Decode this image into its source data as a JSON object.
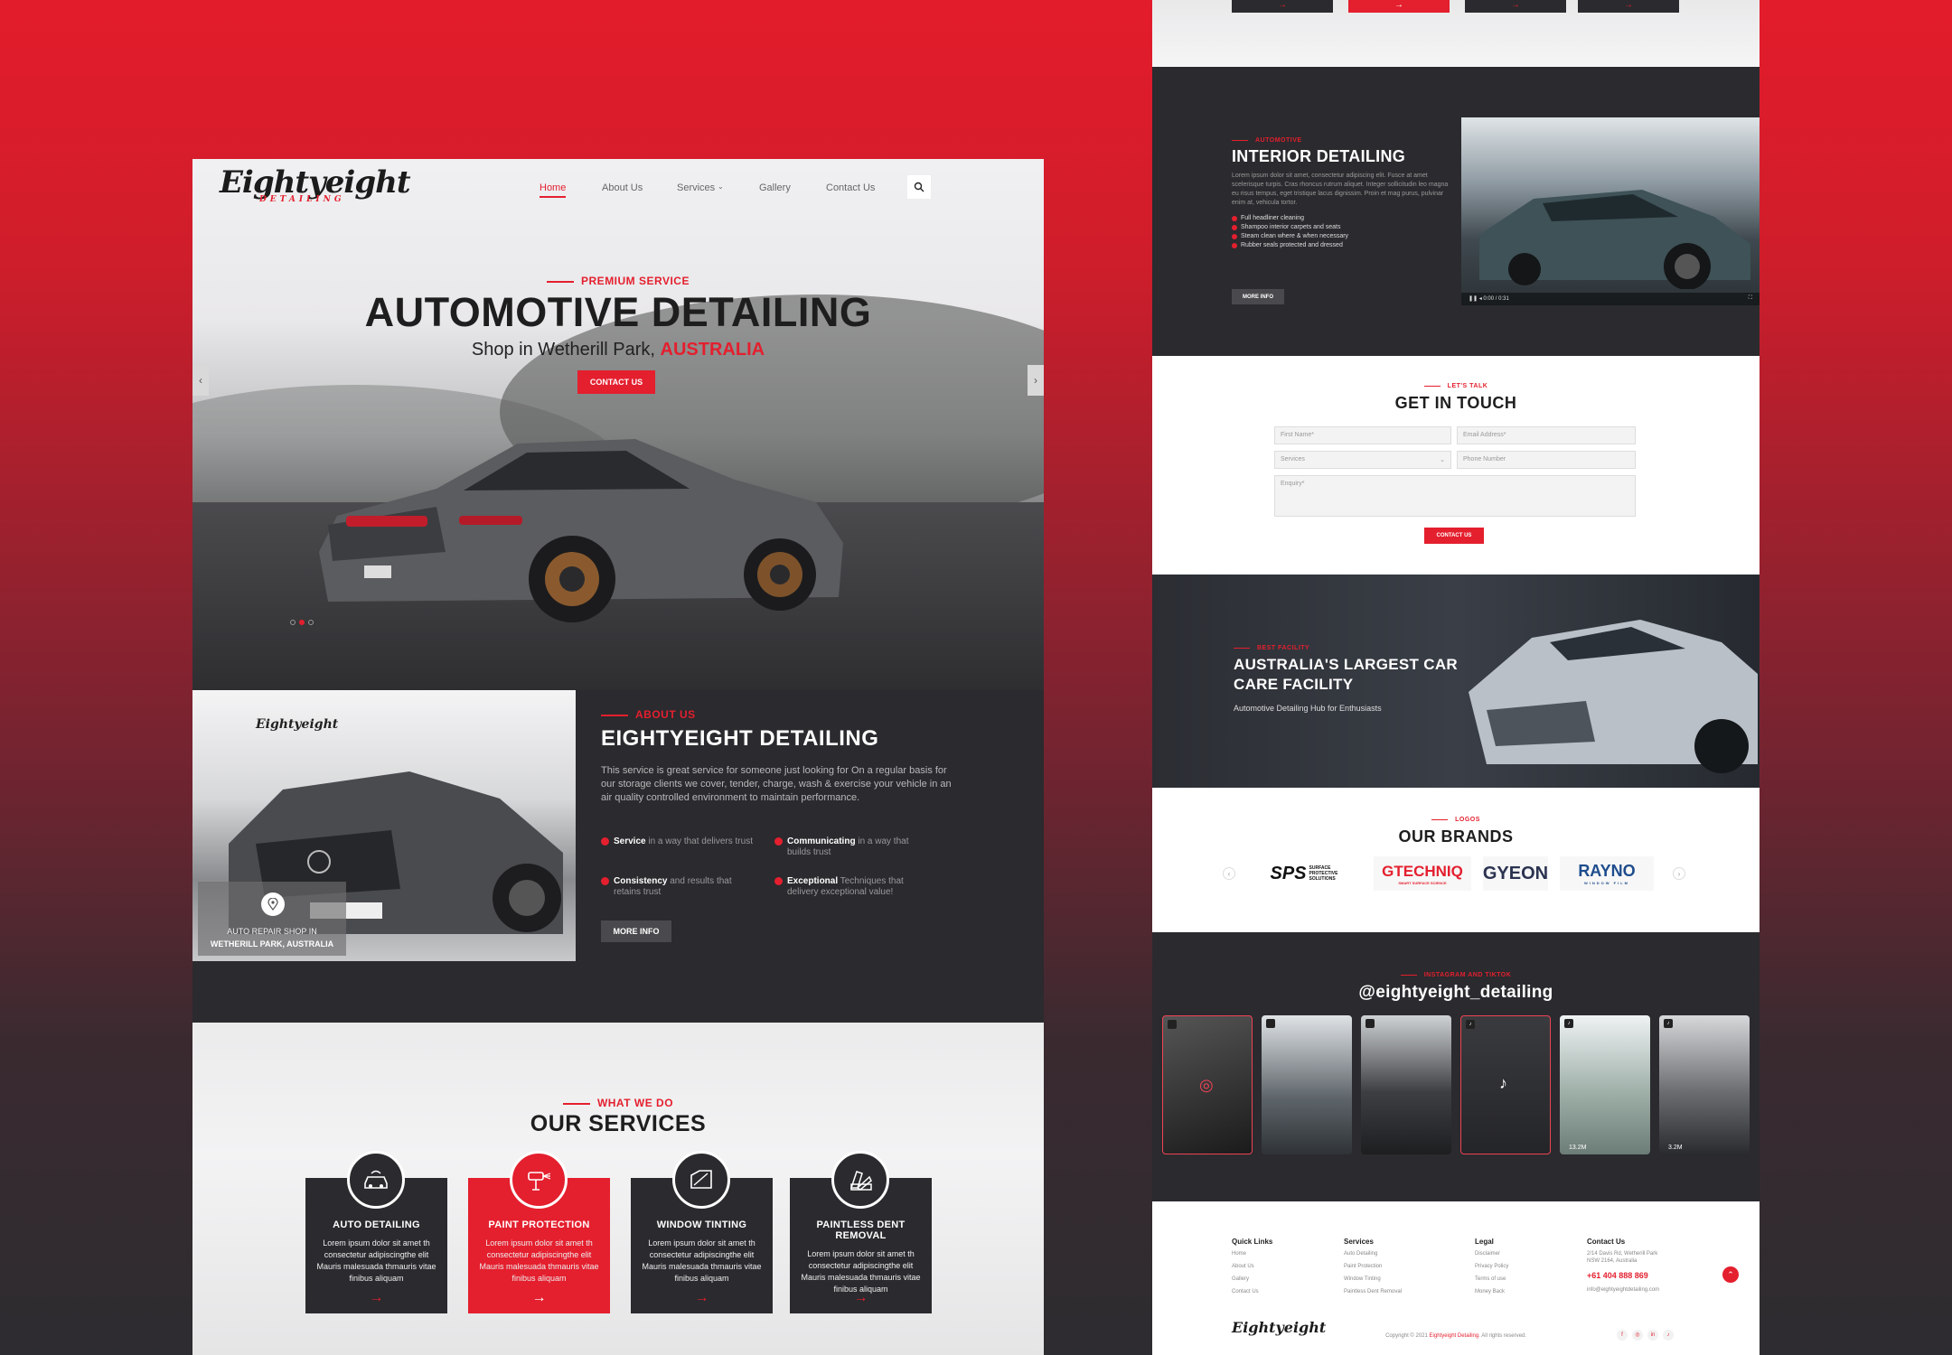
{
  "colors": {
    "accent": "#e41f2e",
    "dark": "#2b2a2e",
    "background": "#e31c2b"
  },
  "left": {
    "logo": {
      "name": "Eightyeight",
      "sub": "DETAILING"
    },
    "nav": [
      "Home",
      "About Us",
      "Services",
      "Gallery",
      "Contact Us"
    ],
    "hero": {
      "kicker": "PREMIUM SERVICE",
      "title": "AUTOMOTIVE DETAILING",
      "subtitle": "Shop in Wetherill Park,",
      "subtitle_highlight": "AUSTRALIA",
      "button": "CONTACT US",
      "active_slide": 2,
      "slide_count": 3
    },
    "about": {
      "kicker": "ABOUT US",
      "title": "EIGHTYEIGHT DETAILING",
      "text": "This service is great service for someone just looking for On a regular basis for our storage clients we cover, tender, charge, wash & exercise your vehicle in an air quality controlled environment to maintain performance.",
      "badge_line1": "AUTO REPAIR SHOP IN",
      "badge_line2": "WETHERILL PARK,  AUSTRALIA",
      "features": [
        {
          "bold": "Service",
          "rest": " in a way that delivers trust"
        },
        {
          "bold": "Communicating",
          "rest": " in a way that builds trust"
        },
        {
          "bold": "Consistency",
          "rest": " and results that retains trust"
        },
        {
          "bold": "Exceptional",
          "rest": " Techniques that delivery exceptional value!"
        }
      ],
      "button": "MORE INFO"
    },
    "services": {
      "kicker": "WHAT WE DO",
      "title": "OUR SERVICES",
      "cards": [
        {
          "title": "AUTO DETAILING",
          "text": "Lorem ipsum dolor sit amet th consectetur adipiscingthe elit Mauris malesuada thmauris vitae finibus aliquam",
          "icon": "car-wash-icon"
        },
        {
          "title": "PAINT PROTECTION",
          "text": "Lorem ipsum dolor sit amet th consectetur adipiscingthe elit Mauris malesuada thmauris vitae finibus aliquam",
          "icon": "spray-gun-icon"
        },
        {
          "title": "WINDOW TINTING",
          "text": "Lorem ipsum dolor sit amet th consectetur adipiscingthe elit Mauris malesuada thmauris vitae finibus aliquam",
          "icon": "window-tint-icon"
        },
        {
          "title": "PAINTLESS DENT REMOVAL",
          "text": "Lorem ipsum dolor sit amet th consectetur adipiscingthe elit Mauris malesuada thmauris vitae finibus aliquam",
          "icon": "swatch-icon"
        }
      ]
    }
  },
  "right": {
    "interior": {
      "kicker": "AUTOMOTIVE",
      "title": "INTERIOR DETAILING",
      "text": "Lorem ipsum dolor sit amet, consectetur adipiscing elit. Fusce at amet scelerisque turpis. Cras rhoncus rutrum aliquet. Integer sollicitudin leo magna eu risus tempus, eget tristique lacus dignissim. Proin et mag purus, pulvinar enim at, vehicula tortor.",
      "bullets": [
        "Full headliner cleaning",
        "Shampoo interior carpets and seats",
        "Steam clean where & when necessary",
        "Rubber seals protected and dressed"
      ],
      "button": "MORE INFO",
      "video_time": "0:00 / 0:31"
    },
    "contact": {
      "kicker": "LET'S TALK",
      "title": "GET IN TOUCH",
      "fields": {
        "first_name": "First Name*",
        "email": "Email Address*",
        "services": "Services",
        "phone": "Phone Number",
        "enquiry": "Enquiry*"
      },
      "button": "CONTACT US"
    },
    "facility": {
      "kicker": "BEST FACILITY",
      "title": "AUSTRALIA'S LARGEST CAR CARE FACILITY",
      "subtitle": "Automotive Detailing Hub for Enthusiasts"
    },
    "brands": {
      "kicker": "LOGOS",
      "title": "OUR BRANDS",
      "items": [
        "SPS",
        "GTECHNIQ",
        "GYEON",
        "RAYNO"
      ],
      "sps_sub": "SURFACE PROTECTIVE SOLUTIONS",
      "gtech_sub": "SMART SURFACE SCIENCE",
      "rayno_sub": "WINDOW FILM"
    },
    "instagram": {
      "kicker": "INSTAGRAM AND TIKTOK",
      "handle": "@eightyeight_detailing",
      "counts": [
        "13.2M",
        "3.2M"
      ]
    },
    "footer": {
      "quick_links": {
        "title": "Quick Links",
        "items": [
          "Home",
          "About Us",
          "Gallery",
          "Contact Us"
        ]
      },
      "services": {
        "title": "Services",
        "items": [
          "Auto Detailing",
          "Paint Protection",
          "Window Tinting",
          "Paintless Dent Removal"
        ]
      },
      "legal": {
        "title": "Legal",
        "items": [
          "Disclaimer",
          "Privacy Policy",
          "Terms of use",
          "Money Back"
        ]
      },
      "contact": {
        "title": "Contact Us",
        "address1": "2/14 Davis Rd, Wetherill Park",
        "address2": "NSW 2164, Australia",
        "phone": "+61 404 888 869",
        "email": "info@eightyeightdetailing.com"
      },
      "copyright_pre": "Copyright © 2021 ",
      "copyright_brand": "Eightyeight Detailing",
      "copyright_post": ". All rights reserved.",
      "logo": "Eightyeight"
    }
  }
}
